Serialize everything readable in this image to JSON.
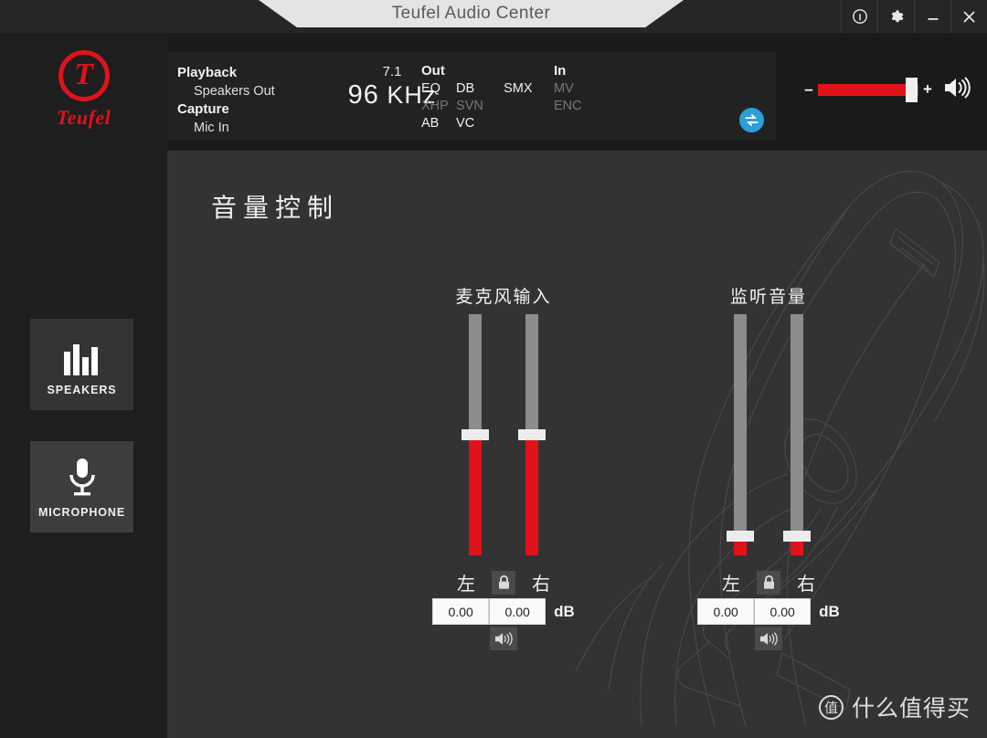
{
  "window": {
    "title": "Teufel Audio Center",
    "controls": [
      {
        "name": "info-button",
        "icon": "info-icon"
      },
      {
        "name": "settings-button",
        "icon": "gear-icon"
      },
      {
        "name": "minimize-button",
        "icon": "minimize-icon"
      },
      {
        "name": "close-button",
        "icon": "close-icon"
      }
    ]
  },
  "sidebar": {
    "logo": {
      "mark": "T",
      "wordmark": "Teufel"
    },
    "items": [
      {
        "label": "SPEAKERS",
        "icon": "equalizer-bars-icon",
        "active": false
      },
      {
        "label": "MICROPHONE",
        "icon": "microphone-icon",
        "active": true
      }
    ]
  },
  "status": {
    "playback_label": "Playback",
    "playback_value": "Speakers Out",
    "capture_label": "Capture",
    "capture_value": "Mic In",
    "channels": "7.1",
    "rate_number": "96",
    "rate_unit": "KHz",
    "out_label": "Out",
    "out_flags": [
      {
        "label": "EQ",
        "on": true
      },
      {
        "label": "DB",
        "on": true
      },
      {
        "label": "SMX",
        "on": true
      },
      {
        "label": "XHP",
        "on": false
      },
      {
        "label": "SVN",
        "on": false
      },
      {
        "label": "AB",
        "on": true
      },
      {
        "label": "VC",
        "on": true
      }
    ],
    "in_label": "In",
    "in_flags": [
      {
        "label": "MV",
        "on": false
      },
      {
        "label": "ENC",
        "on": false
      }
    ],
    "swap_icon": "swap-arrows-icon"
  },
  "master_volume": {
    "minus_label": "–",
    "plus_label": "+",
    "value_percent": 93,
    "speaker_icon": "speaker-icon"
  },
  "main": {
    "page_title": "音量控制",
    "groups": [
      {
        "name": "microphone-input",
        "title": "麦克风输入",
        "left_label": "左",
        "right_label": "右",
        "unit": "dB",
        "lock_icon": "lock-closed-icon",
        "mute_icon": "speaker-icon",
        "channels": [
          {
            "label": "左",
            "value": "0.00",
            "fill_percent": 50
          },
          {
            "label": "右",
            "value": "0.00",
            "fill_percent": 50
          }
        ]
      },
      {
        "name": "monitor-volume",
        "title": "监听音量",
        "left_label": "左",
        "right_label": "右",
        "unit": "dB",
        "lock_icon": "lock-closed-icon",
        "mute_icon": "speaker-icon",
        "channels": [
          {
            "label": "左",
            "value": "0.00",
            "fill_percent": 8
          },
          {
            "label": "右",
            "value": "0.00",
            "fill_percent": 8
          }
        ]
      }
    ],
    "background_graphic": "headset-wireframe"
  },
  "watermark": {
    "badge": "值",
    "text": "什么值得买"
  },
  "colors": {
    "brand_red": "#e2111a",
    "accent_blue": "#2a9fd8",
    "panel": "#333333",
    "sidebar": "#1e1e1e",
    "titlebar": "#262626"
  }
}
